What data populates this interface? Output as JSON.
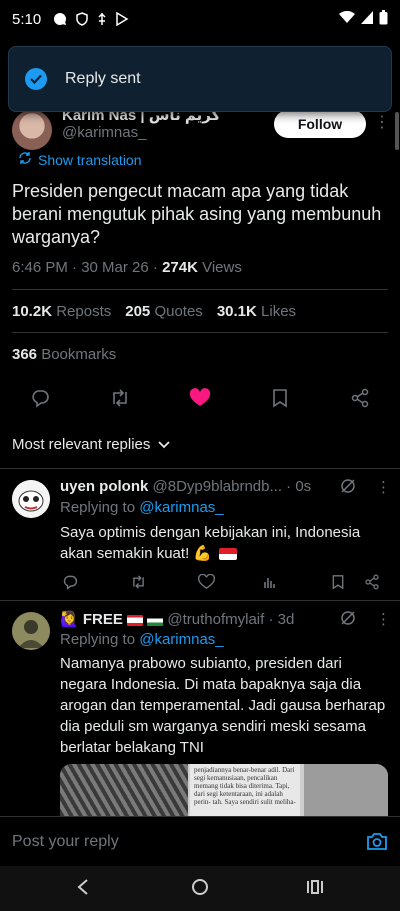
{
  "status_bar": {
    "time": "5:10"
  },
  "toast": {
    "message": "Reply sent"
  },
  "author": {
    "name": "Karim Nas | كريم ناس",
    "handle": "@karimnas_",
    "follow_label": "Follow"
  },
  "translate_label": "Show translation",
  "tweet": {
    "text": "Presiden pengecut macam apa yang tidak berani mengutuk pihak asing yang membunuh warganya?",
    "time": "6:46 PM · 30 Mar 26 · ",
    "views_count": "274K",
    "views_label": " Views"
  },
  "stats": {
    "reposts_count": "10.2K",
    "reposts_label": "Reposts",
    "quotes_count": "205",
    "quotes_label": "Quotes",
    "likes_count": "30.1K",
    "likes_label": "Likes",
    "bookmarks_count": "366",
    "bookmarks_label": "Bookmarks"
  },
  "sort_label": "Most relevant replies",
  "replies": [
    {
      "name": "uyen polonk",
      "handle": "@8Dyp9blabrndb...",
      "time": " · 0s",
      "replying_prefix": "Replying to ",
      "replying_to": "@karimnas_",
      "text": "Saya optimis dengan kebijakan ini, Indonesia akan semakin kuat! 💪"
    },
    {
      "name": "FREE",
      "handle": "@truthofmylaif",
      "time": " · 3d",
      "replying_prefix": "Replying to ",
      "replying_to": "@karimnas_",
      "text": "Namanya prabowo subianto, presiden dari negara Indonesia. Di mata bapaknya saja dia arogan dan temperamental. Jadi gausa berharap dia peduli sm warganya sendiri meski sesama berlatar belakang TNI",
      "media_text": "penjadiannya benar-benar adil. Dari segi kemanusiaan, pencalikan memang tidak bisa diterima. Tapi, dari segi ketentaraan, ini adalah perin- tah. Saya sendiri sulit meliha-"
    }
  ],
  "compose": {
    "placeholder": "Post your reply"
  },
  "colors": {
    "accent": "#1d9bf0",
    "like": "#f91880",
    "background": "#000000"
  }
}
